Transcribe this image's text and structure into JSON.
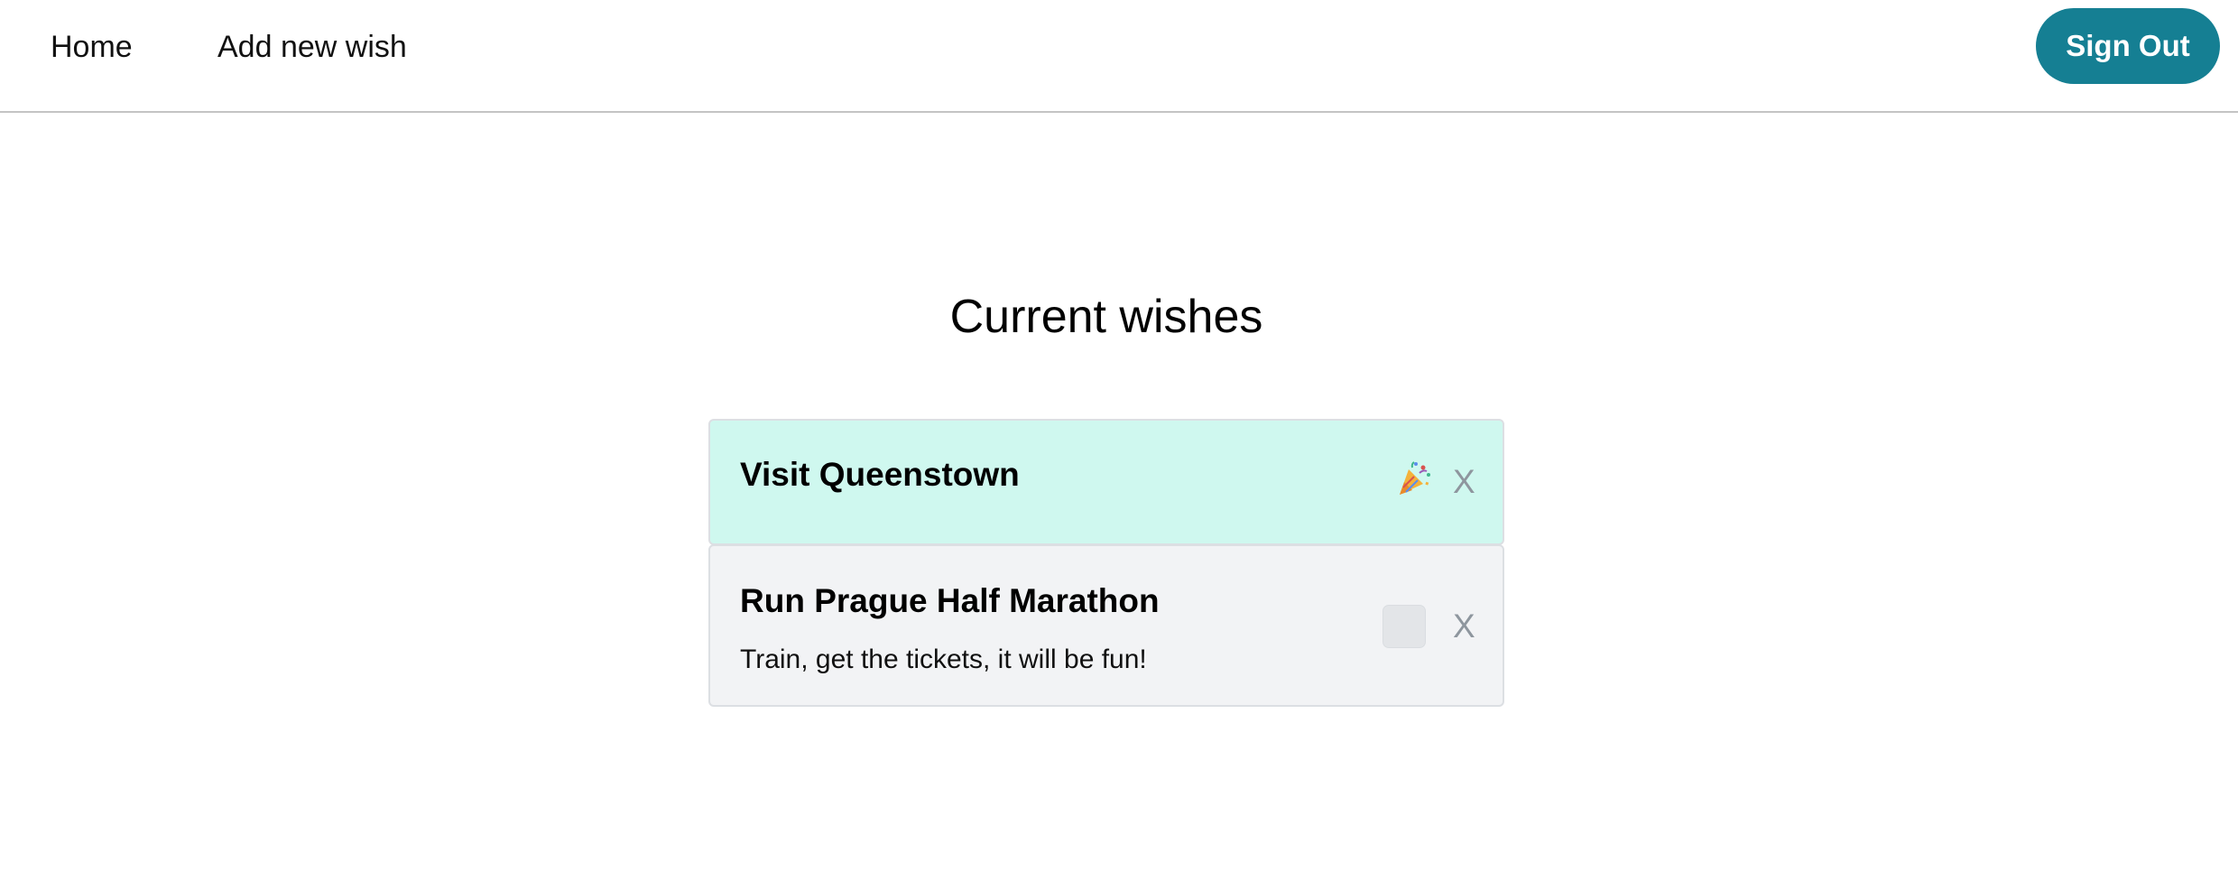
{
  "nav": {
    "home_label": "Home",
    "add_label": "Add new wish",
    "signout_label": "Sign Out"
  },
  "main": {
    "title": "Current wishes",
    "wishes": [
      {
        "title": "Visit Queenstown",
        "description": "",
        "status": "done",
        "status_icon": "party-popper-icon",
        "remove_label": "X"
      },
      {
        "title": "Run Prague Half Marathon",
        "description": "Train, get the tickets, it will be fun!",
        "status": "not-done",
        "remove_label": "X"
      }
    ]
  },
  "colors": {
    "accent": "#157f93",
    "done_card": "#cff8ef",
    "pending_card": "#f2f3f5",
    "remove": "#8e969e"
  }
}
